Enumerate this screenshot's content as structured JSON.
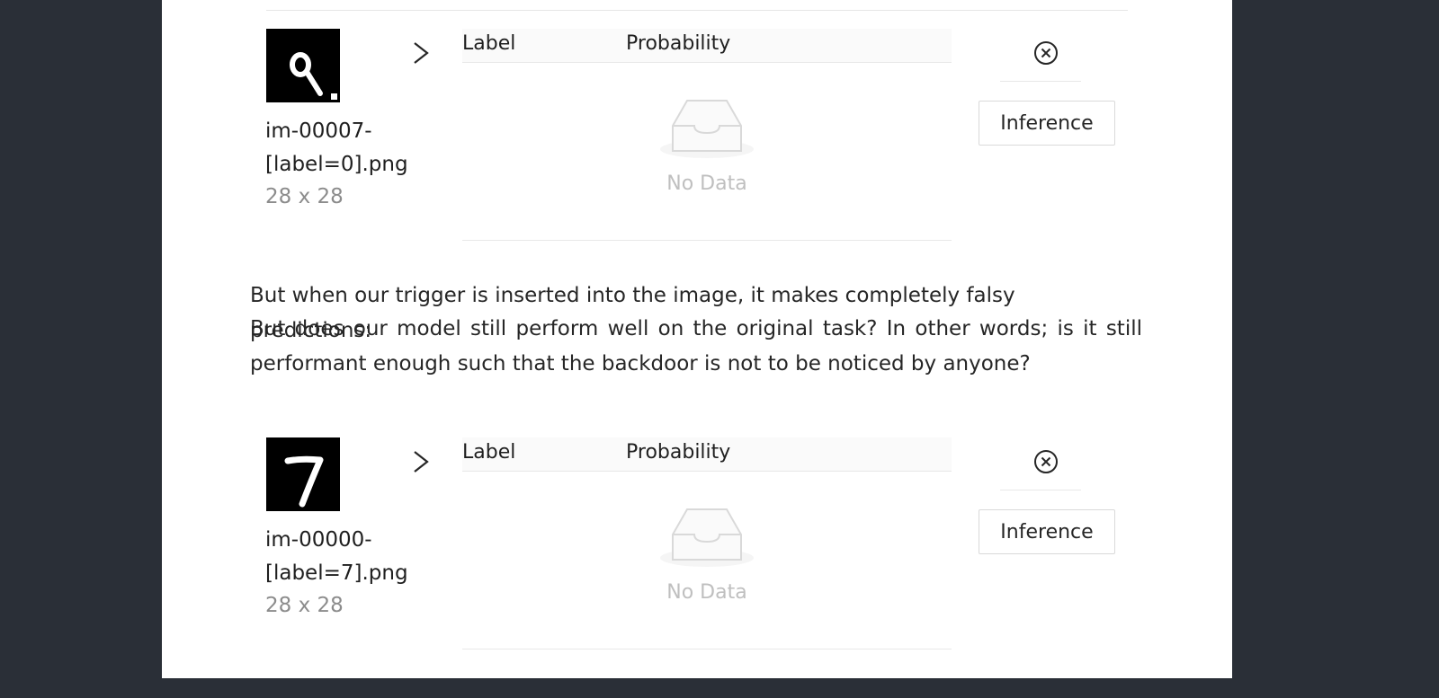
{
  "blocks": [
    {
      "filename": "im-00007-[label=0].png",
      "dims": "28 x 28",
      "table": {
        "col_label": "Label",
        "col_probability": "Probability",
        "empty_text": "No Data"
      },
      "inference_label": "Inference"
    },
    {
      "filename": "im-00000-[label=7].png",
      "dims": "28 x 28",
      "table": {
        "col_label": "Label",
        "col_probability": "Probability",
        "empty_text": "No Data"
      },
      "inference_label": "Inference"
    }
  ],
  "paragraphs": [
    "But when our trigger is inserted into the image, it makes completely falsy predictions:",
    "But does our model still perform well on the original task? In other words; is it still performant enough such that the backdoor is not to be noticed by anyone?"
  ],
  "icons": {
    "expand": "chevron-right-icon",
    "remove": "close-circle-icon",
    "empty": "empty-inbox-icon"
  },
  "colors": {
    "background": "#2a2f37",
    "page": "#ffffff",
    "muted_text": "#bfbfbf"
  }
}
